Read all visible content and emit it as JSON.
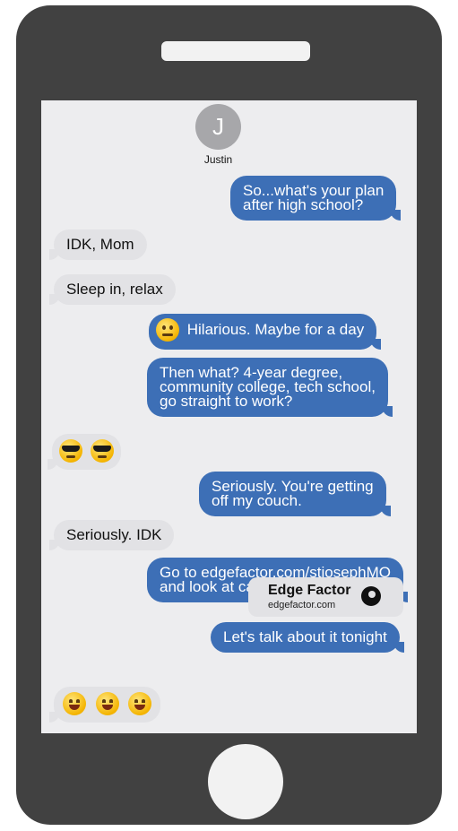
{
  "contact": {
    "initial": "J",
    "name": "Justin"
  },
  "messages": {
    "m1": [
      "So...what's your plan",
      "after high school?"
    ],
    "m2": "IDK, Mom",
    "m3": "Sleep in, relax",
    "m4": "Hilarious. Maybe for a day",
    "m5": [
      "Then what? 4-year degree,",
      "community college, tech school,",
      "go straight to work?"
    ],
    "m7": [
      "Seriously. You're getting",
      "off my couch."
    ],
    "m8": "Seriously. IDK",
    "m9": [
      "Go to edgefactor.com/stjosephMO",
      "and look at careers, videos"
    ],
    "m11": "Let's talk about it tonight"
  },
  "link_card": {
    "title": "Edge Factor",
    "url": "edgefactor.com"
  },
  "emojis": {
    "m4": [
      "neutral-face"
    ],
    "m6": [
      "sunglasses-face",
      "sunglasses-face"
    ],
    "m12": [
      "smiling-face",
      "smiling-face",
      "smiling-face"
    ]
  },
  "colors": {
    "outgoing_bubble": "#3d6fb6",
    "incoming_bubble": "#e2e2e5",
    "phone_body": "#414141",
    "screen_bg": "#ededef"
  }
}
